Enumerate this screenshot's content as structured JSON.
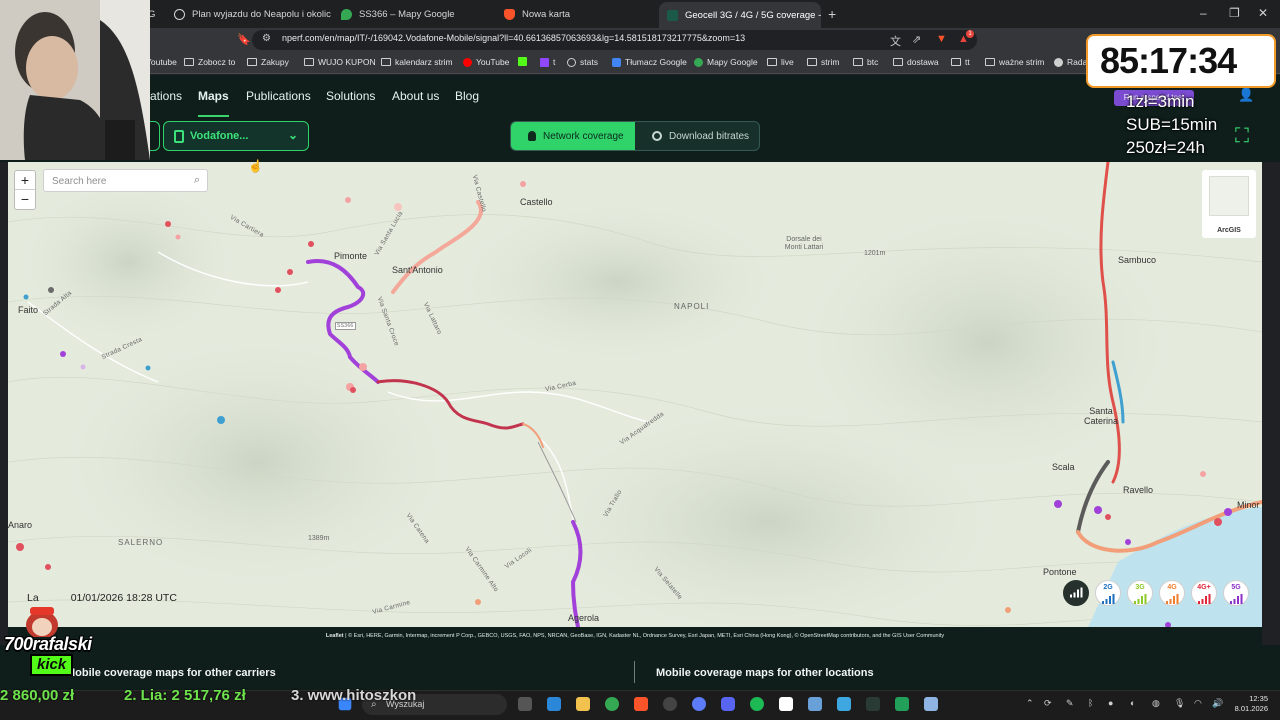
{
  "browser": {
    "tabs": [
      {
        "label": "Plan wyjazdu do Neapolu i okolic - G",
        "active": false
      },
      {
        "label": "SS366 – Mapy Google",
        "active": false
      },
      {
        "label": "Nowa karta",
        "active": false
      },
      {
        "label": "Geocell 3G / 4G / 5G coverage -",
        "active": true
      }
    ],
    "partial_tab_label": "G",
    "url": "nperf.com/en/map/IT/-/169042.Vodafone-Mobile/signal?ll=40.66136857063693&lg=14.581518173217775&zoom=13",
    "bookmarks": [
      "Youtube",
      "Zobocz to",
      "Zakupy",
      "WUJO KUPON",
      "kalendarz strim",
      "YouTube",
      "t",
      "stats",
      "Tłumacz Google",
      "Mapy Google",
      "live",
      "strim",
      "btc",
      "dostawa",
      "tt",
      "ważne strim",
      "Radar ope"
    ],
    "extension_badge": "1"
  },
  "site": {
    "nav": [
      "ations",
      "Maps",
      "Publications",
      "Solutions",
      "About us",
      "Blog"
    ],
    "active_nav": "Maps",
    "carrier_select": "Vodafone...",
    "segments": [
      {
        "label": "Network coverage",
        "active": true
      },
      {
        "label": "Download bitrates",
        "active": false
      }
    ],
    "speed_test_button": "Run a speed test"
  },
  "map": {
    "zoom_in": "+",
    "zoom_out": "−",
    "search_placeholder": "Search here",
    "basemap_label": "ArcGIS",
    "places": [
      "Castello",
      "Pimonte",
      "Sant'Antonio",
      "Faito",
      "Sambuco",
      "Santa Caterina",
      "Scala",
      "Ravello",
      "Pontone",
      "Agerola",
      "Minor",
      "Anaro",
      "NAPOLI",
      "SALERNO",
      "Dorsale dei Monti Lattari",
      "1201m",
      "1389m"
    ],
    "roads": [
      "Via Cerba",
      "Via Acquafredda",
      "Via Tralio",
      "Via Locoli",
      "Via Catena",
      "Via Carmine",
      "Via Santa Croce",
      "Via Lattaro",
      "Via Castello",
      "Via Santa Lucia",
      "SS366",
      "Strada Alta",
      "Strada Cresta",
      "Via Carmine Alto",
      "Via Cartiera",
      "Via Selatelle"
    ],
    "legend": [
      {
        "label": "",
        "color": "#3a4240"
      },
      {
        "label": "2G",
        "color": "#1c6fbf"
      },
      {
        "label": "3G",
        "color": "#8ac926"
      },
      {
        "label": "4G",
        "color": "#ef7d2c"
      },
      {
        "label": "4G+",
        "color": "#e0253b"
      },
      {
        "label": "5G",
        "color": "#8b2fc9"
      }
    ],
    "last_update_prefix": "La",
    "last_update_date": "01/01/2026 18:28 UTC",
    "attribution_lead": "Leaflet",
    "attribution": "| © Esri, HERE, Garmin, Intermap, increment P Corp., GEBCO, USGS, FAO, NPS, NRCAN, GeoBase, IGN, Kadaster NL, Ordnance Survey, Esri Japan, METI, Esri China (Hong Kong), © OpenStreetMap contributors, and the GIS User Community"
  },
  "footer": {
    "left": "Mobile coverage maps for other carriers",
    "right": "Mobile coverage maps for other locations"
  },
  "stream": {
    "timer": "85:17:34",
    "rates": [
      "1zł=3min",
      "SUB=15min",
      "250zł=24h"
    ],
    "logo_name": "700rafalski",
    "logo_platform": "kick",
    "ticker": [
      {
        "text": "2 860,00 zł",
        "color": "#6fe34d"
      },
      {
        "text": "2. Lia: 2 517,76 zł",
        "color": "#6fe34d"
      },
      {
        "text": "3. www.hitoszkon",
        "color": "#d8d8d8"
      }
    ]
  },
  "taskbar": {
    "search_placeholder": "Wyszukaj",
    "time": "12:35",
    "date": "8.01.2026"
  }
}
